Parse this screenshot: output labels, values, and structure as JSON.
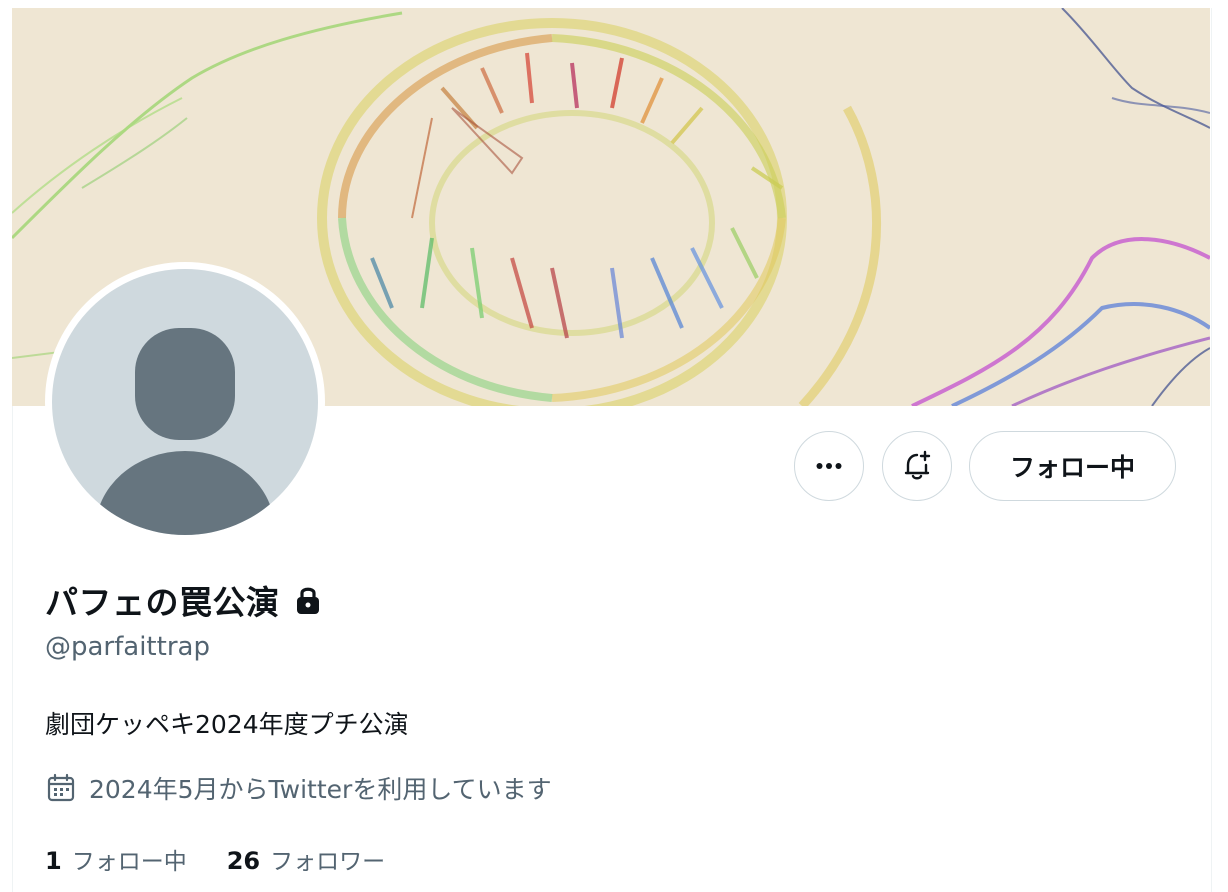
{
  "profile": {
    "display_name": "パフェの罠公演",
    "handle": "@parfaittrap",
    "bio": "劇団ケッペキ2024年度プチ公演",
    "joined": "2024年5月からTwitterを利用しています",
    "protected_icon": "lock-icon",
    "joined_icon": "calendar-icon"
  },
  "actions": {
    "more_icon": "more-horizontal-icon",
    "notify_icon": "bell-plus-icon",
    "follow_label": "フォロー中"
  },
  "stats": {
    "following_count": "1",
    "following_label": "フォロー中",
    "followers_count": "26",
    "followers_label": "フォロワー"
  },
  "colors": {
    "primary_text": "#0f1419",
    "secondary_text": "#536471",
    "border": "#cfd9de",
    "banner_bg": "#efe6d3",
    "avatar_bg": "#cfd9de",
    "avatar_fg": "#66757f"
  }
}
